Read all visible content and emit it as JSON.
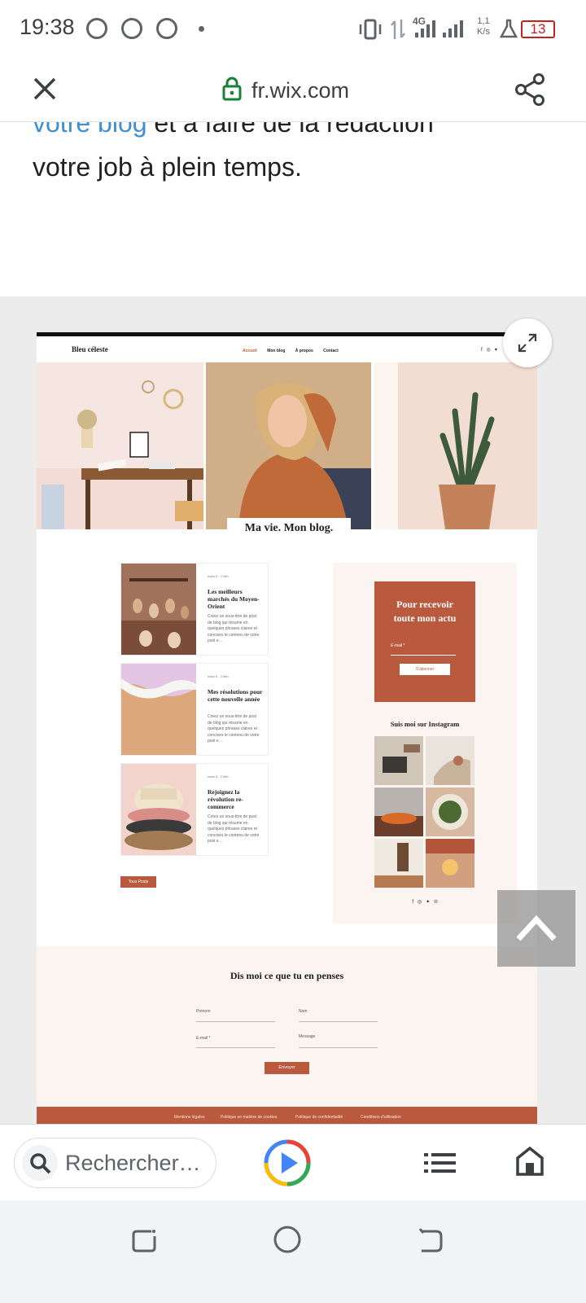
{
  "status_bar": {
    "time": "19:38",
    "network": "4G",
    "speed_value": "1,1",
    "speed_unit": "K/s",
    "battery": "13"
  },
  "browser": {
    "domain": "fr.wix.com",
    "search_placeholder": "Rechercher…",
    "close_icon": "close-icon",
    "share_icon": "share-icon"
  },
  "article": {
    "line1_link": "votre blog",
    "line1_rest": " et à faire de la rédaction",
    "line2": "votre job à plein temps."
  },
  "site": {
    "brand": "Bleu céleste",
    "nav": [
      "Accueil",
      "Mon blog",
      "À propos",
      "Contact"
    ],
    "hero_caption": "Ma vie. Mon blog.",
    "posts": [
      {
        "meta": "mars 5 · 2 Min",
        "title": "Les meilleurs marchés du Moyen-Orient",
        "excerpt": "Créez un sous-titre de post de blog qui résume en quelques phrases claires et concises le contenu de votre post e…"
      },
      {
        "meta": "mars 5 · 2 Min",
        "title": "Mes résolutions pour cette nouvelle année",
        "excerpt": "Créez un sous-titre de post de blog qui résume en quelques phrases claires et concises le contenu de votre post e…"
      },
      {
        "meta": "mars 5 · 2 Min",
        "title": "Rejoignez la révolution re-commerce",
        "excerpt": "Créez un sous-titre de post de blog qui résume en quelques phrases claires et concises le contenu de votre post e…"
      }
    ],
    "all_posts_button": "Tous Posts",
    "subscribe": {
      "title_line1": "Pour recevoir",
      "title_line2": "toute mon actu",
      "email_label": "E-mail *",
      "button": "S'abonner"
    },
    "instagram_title": "Suis moi sur Instagram",
    "contact": {
      "title": "Dis moi ce que tu en penses",
      "first_name": "Prénom",
      "last_name": "Nom",
      "email": "E-mail *",
      "message": "Message",
      "send": "Envoyer"
    },
    "footer_links": [
      "Mentions légales",
      "Politique en matière de cookies",
      "Politique de confidentialité",
      "Conditions d'utilisation"
    ]
  },
  "colors": {
    "accent": "#b95a3e",
    "link_blue": "#3f8fd2",
    "cream": "#fbf4f1"
  }
}
